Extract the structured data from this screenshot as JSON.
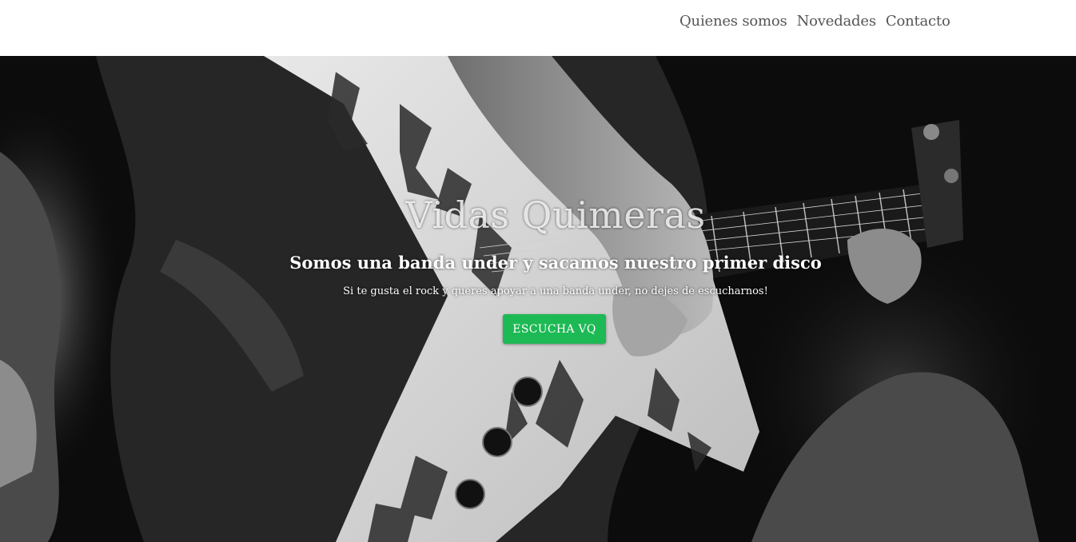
{
  "nav": {
    "items": [
      {
        "label": "Quienes somos"
      },
      {
        "label": "Novedades"
      },
      {
        "label": "Contacto"
      }
    ]
  },
  "hero": {
    "title": "Vidas Quimeras",
    "subtitle": "Somos una banda under y sacamos nuestro primer disco",
    "text": "Si te gusta el rock y queres apoyar a una banda under, no dejes de escucharnos!",
    "cta_label": "ESCUCHA VQ",
    "background": "grayscale-photo-guitarist-playing-explorer-guitar"
  },
  "colors": {
    "accent": "#1db954",
    "nav_text": "#555555",
    "header_bg": "#ffffff"
  }
}
